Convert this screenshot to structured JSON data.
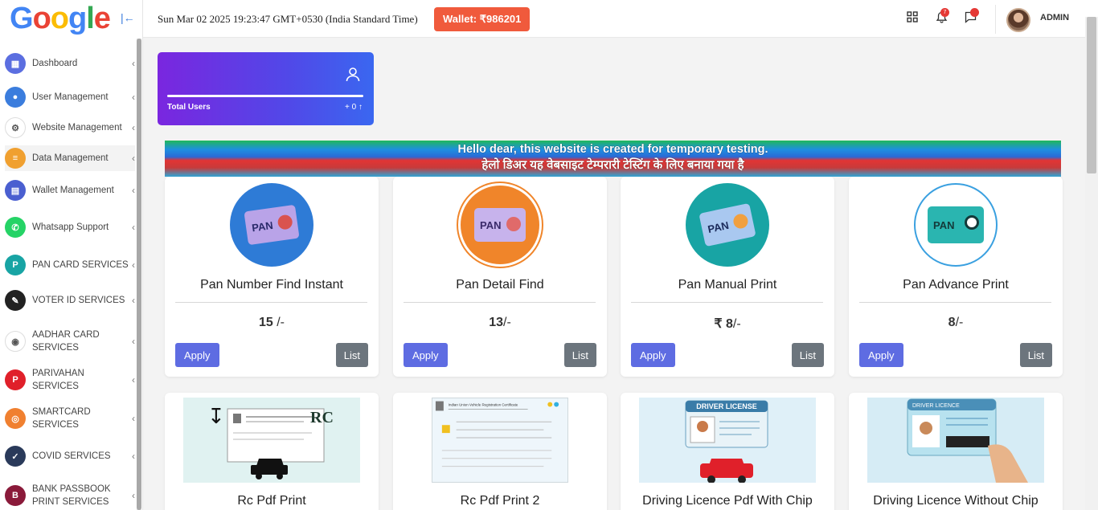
{
  "logo": {
    "text": "Google",
    "letters": [
      "G",
      "o",
      "o",
      "g",
      "l",
      "e"
    ],
    "colors": [
      "#4285F4",
      "#EA4335",
      "#FBBC05",
      "#4285F4",
      "#34A853",
      "#EA4335"
    ]
  },
  "header": {
    "datetime": "Sun Mar 02 2025 19:23:47 GMT+0530 (India Standard Time)",
    "wallet": "Wallet: ₹986201",
    "notification_count": "7",
    "user": "ADMIN"
  },
  "sidebar": {
    "items": [
      {
        "label": "Dashboard",
        "icon": "dashboard-icon"
      },
      {
        "label": "User Management",
        "icon": "user-icon"
      },
      {
        "label": "Website Management",
        "icon": "gear-icon"
      },
      {
        "label": "Data Management",
        "icon": "data-icon"
      },
      {
        "label": "Wallet Management",
        "icon": "wallet-icon"
      },
      {
        "label": "Whatsapp Support",
        "icon": "whatsapp-icon"
      },
      {
        "label": "PAN CARD SERVICES",
        "icon": "pan-icon"
      },
      {
        "label": "VOTER ID SERVICES",
        "icon": "voter-icon"
      },
      {
        "label": "AADHAR CARD SERVICES",
        "icon": "aadhar-icon"
      },
      {
        "label": "PARIVAHAN SERVICES",
        "icon": "parivahan-icon"
      },
      {
        "label": "SMARTCARD SERVICES",
        "icon": "smartcard-icon"
      },
      {
        "label": "COVID SERVICES",
        "icon": "covid-icon"
      },
      {
        "label": "BANK PASSBOOK PRINT SERVICES",
        "icon": "bank-icon"
      }
    ]
  },
  "stat": {
    "label": "Total Users",
    "value": "+ 0"
  },
  "banner": {
    "english": "Hello dear, this website is created for temporary testing.",
    "hindi": "हेलो डिअर यह वेबसाइट टेम्परारी टेस्टिंग के लिए बनाया गया है"
  },
  "services": [
    {
      "title": "Pan Number Find Instant",
      "price": "15",
      "suffix": " /-"
    },
    {
      "title": "Pan Detail Find",
      "price": "13",
      "suffix": "/-"
    },
    {
      "title": "Pan Manual Print",
      "price": "₹ 8",
      "suffix": "/-"
    },
    {
      "title": "Pan Advance Print",
      "price": "8",
      "suffix": "/-"
    }
  ],
  "services2": [
    {
      "title": "Rc Pdf Print",
      "thumb_text": "RC"
    },
    {
      "title": "Rc Pdf Print 2",
      "thumb_text": "Indian Union Vehicle Registration Certificate"
    },
    {
      "title": "Driving Licence Pdf With Chip",
      "thumb_text": "DRIVER LICENSE"
    },
    {
      "title": "Driving Licence Without Chip",
      "thumb_text": "DRIVER LICENCE"
    }
  ],
  "buttons": {
    "apply": "Apply",
    "list": "List"
  },
  "pan_label": "PAN"
}
